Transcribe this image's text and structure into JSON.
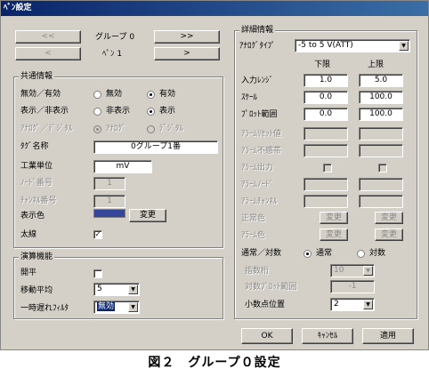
{
  "window": {
    "title": "ﾍﾟﾝ設定"
  },
  "nav": {
    "prev_group": "<<",
    "group_label": "グループ 0",
    "next_group": ">>",
    "prev_pen": "<",
    "pen_label": "ﾍﾟﾝ 1",
    "next_pen": ">"
  },
  "common": {
    "title": "共通情報",
    "enable_label": "無効／有効",
    "enable_off": "無効",
    "enable_on": "有効",
    "display_label": "表示／非表示",
    "display_off": "非表示",
    "display_on": "表示",
    "ad_label": "ｱﾅﾛｸﾞ／ﾃﾞｼﾞﾀﾙ",
    "ad_analog": "ｱﾅﾛｸﾞ",
    "ad_digital": "ﾃﾞｼﾞﾀﾙ",
    "tag_label": "ﾀｸﾞ名称",
    "tag_value": "0グループ1番",
    "unit_label": "工業単位",
    "unit_value": "mV",
    "node_label": "ﾉｰﾄﾞ番号",
    "node_value": "1",
    "channel_label": "ﾁｬﾝﾈﾙ番号",
    "channel_value": "1",
    "color_label": "表示色",
    "color_button": "変更",
    "color_value": "#34459a",
    "thick_label": "太線",
    "thick_checked": "✓"
  },
  "calc": {
    "title": "演算機能",
    "open_label": "開平",
    "ma_label": "移動平均",
    "ma_value": "5",
    "lag_label": "一時遅れﾌｨﾙﾀ",
    "lag_value": "無効"
  },
  "detail": {
    "title": "詳細情報",
    "type_label": "ｱﾅﾛｸﾞﾀｲﾌﾟ",
    "type_value": "-5 to 5 V(ATT)",
    "lower_header": "下限",
    "upper_header": "上限",
    "input_range_label": "入力ﾚﾝｼﾞ",
    "input_lo": "1.0",
    "input_hi": "5.0",
    "scale_label": "ｽｹｰﾙ",
    "scale_lo": "0.0",
    "scale_hi": "100.0",
    "plot_label": "ﾌﾟﾛｯﾄ範囲",
    "plot_lo": "0.0",
    "plot_hi": "100.0",
    "alarm_reset_label": "ｱﾗｰﾑﾘｾｯﾄ値",
    "alarm_deadband_label": "ｱﾗｰﾑ不感帯",
    "alarm_output_label": "ｱﾗｰﾑ出力",
    "alarm_node_label": "ｱﾗｰﾑﾉｰﾄﾞ",
    "alarm_channel_label": "ｱﾗｰﾑﾁｬﾝﾈﾙ",
    "normal_color_label": "正常色",
    "alarm_color_label": "ｱﾗｰﾑ色",
    "change_button": "変更",
    "mode_label": "通常／対数",
    "mode_normal": "通常",
    "mode_log": "対数",
    "exponent_label": "指数桁",
    "exponent_value": "10",
    "log_plot_label": "対数ﾌﾟﾛｯﾄ範囲",
    "log_plot_value": "-1",
    "decimal_label": "小数点位置",
    "decimal_value": "2"
  },
  "footer": {
    "ok": "OK",
    "cancel": "ｷｬﾝｾﾙ",
    "apply": "適用"
  },
  "caption": "図２　グループ０設定"
}
